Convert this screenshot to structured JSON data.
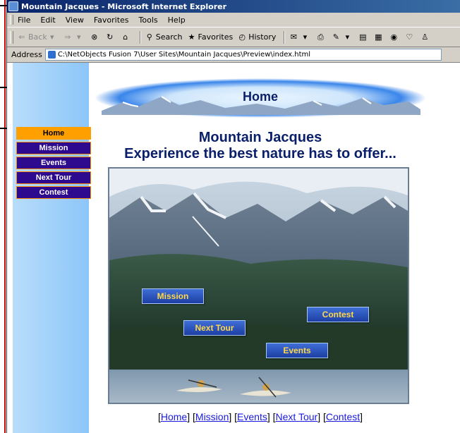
{
  "window": {
    "title": "Mountain Jacques - Microsoft Internet Explorer"
  },
  "menu": {
    "items": [
      "File",
      "Edit",
      "View",
      "Favorites",
      "Tools",
      "Help"
    ]
  },
  "toolbar": {
    "back_label": "Back",
    "search_label": "Search",
    "favorites_label": "Favorites",
    "history_label": "History"
  },
  "address": {
    "label": "Address",
    "url": "C:\\NetObjects Fusion 7\\User Sites\\Mountain Jacques\\Preview\\index.html"
  },
  "banner": {
    "title": "Home"
  },
  "nav": {
    "items": [
      {
        "label": "Home",
        "active": true
      },
      {
        "label": "Mission",
        "active": false
      },
      {
        "label": "Events",
        "active": false
      },
      {
        "label": "Next Tour",
        "active": false
      },
      {
        "label": "Contest",
        "active": false
      }
    ]
  },
  "page": {
    "headline": "Mountain Jacques",
    "subheadline": "Experience the best nature has to offer..."
  },
  "photo_buttons": {
    "mission": "Mission",
    "contest": "Contest",
    "next_tour": "Next Tour",
    "events": "Events"
  },
  "footer": {
    "links": [
      "Home",
      "Mission",
      "Events",
      "Next Tour",
      "Contest"
    ]
  },
  "colors": {
    "nav_active": "#ffa000",
    "nav_inactive": "#2d0a8e",
    "nav_border": "#ff8a00",
    "heading": "#0a1f6b",
    "link": "#1a1adf",
    "sky": "#8cc6f8"
  }
}
